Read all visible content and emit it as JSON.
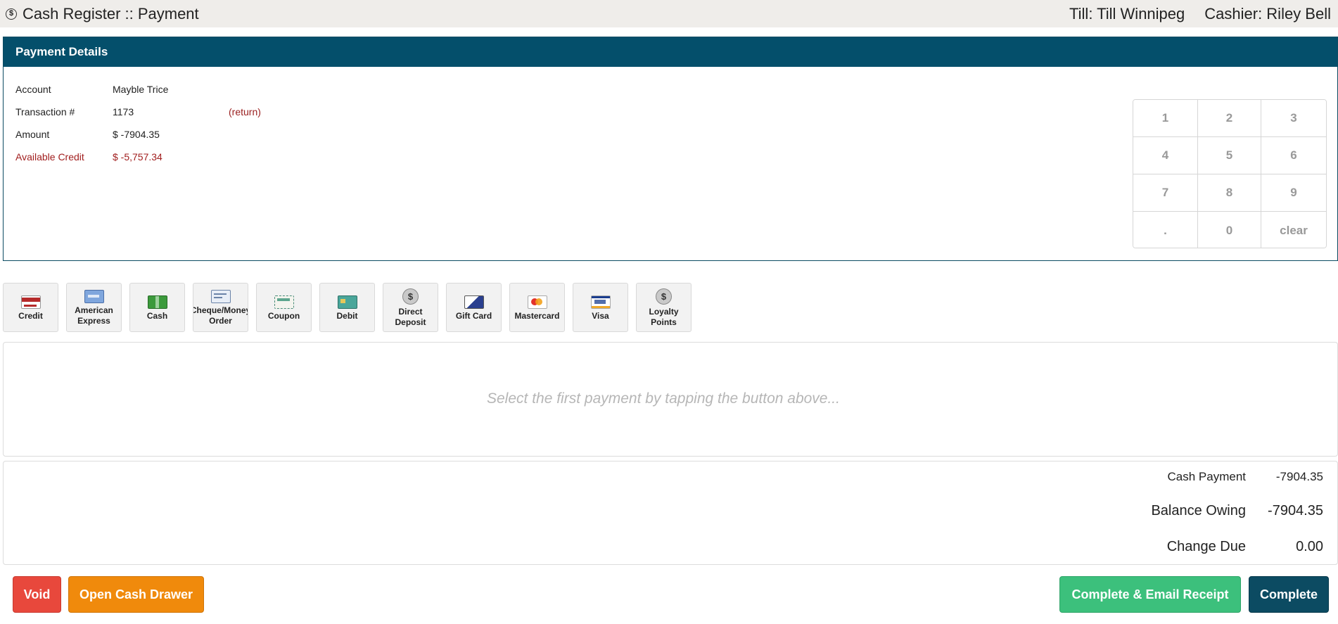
{
  "header": {
    "icon": "dollar-circle-icon",
    "title": "Cash Register :: Payment",
    "till": "Till: Till Winnipeg",
    "cashier": "Cashier: Riley Bell"
  },
  "details": {
    "title": "Payment Details",
    "rows": [
      {
        "label": "Account",
        "value": "Mayble Trice",
        "note": ""
      },
      {
        "label": "Transaction #",
        "value": "1173",
        "note": "(return)"
      },
      {
        "label": "Amount",
        "value": "$ -7904.35",
        "note": ""
      },
      {
        "label": "Available Credit",
        "value": "$ -5,757.34",
        "note": ""
      }
    ]
  },
  "keypad": [
    "1",
    "2",
    "3",
    "4",
    "5",
    "6",
    "7",
    "8",
    "9",
    ".",
    "0",
    "clear"
  ],
  "methods": [
    {
      "line1": "Credit",
      "line2": "",
      "icon": "credit-card-icon"
    },
    {
      "line1": "American",
      "line2": "Express",
      "icon": "american-express-card-icon"
    },
    {
      "line1": "Cash",
      "line2": "",
      "icon": "cash-icon"
    },
    {
      "line1": "Cheque/Money",
      "line2": "Order",
      "icon": "cheque-icon"
    },
    {
      "line1": "Coupon",
      "line2": "",
      "icon": "coupon-icon"
    },
    {
      "line1": "Debit",
      "line2": "",
      "icon": "debit-card-icon"
    },
    {
      "line1": "Direct",
      "line2": "Deposit",
      "icon": "direct-deposit-icon"
    },
    {
      "line1": "Gift Card",
      "line2": "",
      "icon": "gift-card-icon"
    },
    {
      "line1": "Mastercard",
      "line2": "",
      "icon": "mastercard-icon"
    },
    {
      "line1": "Visa",
      "line2": "",
      "icon": "visa-icon"
    },
    {
      "line1": "Loyalty",
      "line2": "Points",
      "icon": "loyalty-points-icon"
    }
  ],
  "payments": {
    "hint": "Select the first payment by tapping the button above..."
  },
  "totals": {
    "cash_payment_label": "Cash Payment",
    "cash_payment_value": "-7904.35",
    "balance_owing_label": "Balance Owing",
    "balance_owing_value": "-7904.35",
    "change_due_label": "Change Due",
    "change_due_value": "0.00"
  },
  "actions": {
    "void": "Void",
    "open_drawer": "Open Cash Drawer",
    "complete_email": "Complete & Email Receipt",
    "complete": "Complete"
  },
  "colors": {
    "header_bar": "#044f6b",
    "void": "#e8483c",
    "open_drawer": "#f08a0c",
    "complete_email": "#3cc07c",
    "complete": "#0c4b62",
    "credit_text": "#a11e1e"
  }
}
